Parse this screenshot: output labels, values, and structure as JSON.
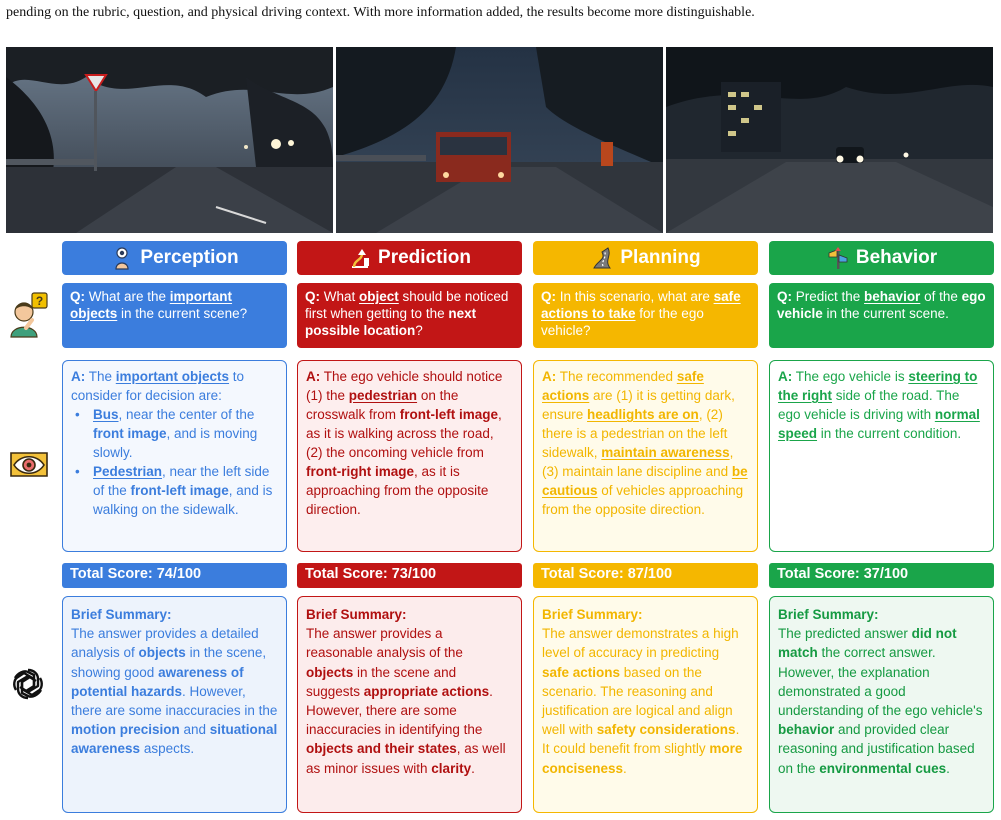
{
  "intro": "pending on the rubric, question, and physical driving context. With more information added, the results become more distinguishable.",
  "colors": {
    "blue": "#3b7ddd",
    "red": "#c21616",
    "yellow": "#f5b700",
    "green": "#1aa54a"
  },
  "side_icons": [
    "thinking-person-icon",
    "eye-icon",
    "openai-logo-icon"
  ],
  "photos": [
    {
      "name": "front-left-image",
      "scene": "night road with trees and yield sign"
    },
    {
      "name": "front-image",
      "scene": "night road with bus"
    },
    {
      "name": "front-right-image",
      "scene": "night road with oncoming vehicle"
    }
  ],
  "perception": {
    "title": "Perception",
    "q_label": "Q:",
    "q_t1": " What are the ",
    "q_u1": "important objects",
    "q_t2": " in the current scene?",
    "a_label": "A:",
    "a_t1": " The ",
    "a_u1": "important objects",
    "a_t2": " to consider for decision are:",
    "b1_u": "Bus",
    "b1_t1": ", near the center of the ",
    "b1_b": "front image",
    "b1_t2": ", and is moving slowly.",
    "b2_u": "Pedestrian",
    "b2_t1": ", near the left side of the ",
    "b2_b": "front-left image",
    "b2_t2": ", and is walking on the sidewalk.",
    "score": "Total Score: 74/100",
    "s_title": "Brief Summary:",
    "s_t1": "The answer provides a detailed analysis of ",
    "s_b1": "objects",
    "s_t2": " in the scene, showing good ",
    "s_b2": "awareness of potential hazards",
    "s_t3": ". However, there are some inaccuracies in the ",
    "s_b3": "motion precision",
    "s_t4": " and ",
    "s_b4": "situational awareness",
    "s_t5": " aspects."
  },
  "prediction": {
    "title": "Prediction",
    "q_label": "Q:",
    "q_t1": " What ",
    "q_u1": "object",
    "q_t2": " should be noticed first when getting to the ",
    "q_b1": "next possible location",
    "q_t3": "?",
    "a_label": "A:",
    "a_t1": " The ego vehicle should notice (1) the ",
    "a_u1": "pedestrian",
    "a_t2": " on the crosswalk from ",
    "a_b1": "front-left image",
    "a_t3": ", as it is walking across the road, (2) the oncoming vehicle from ",
    "a_b2": "front-right image",
    "a_t4": ", as it is approaching from the opposite direction.",
    "score": "Total Score: 73/100",
    "s_title": "Brief Summary:",
    "s_t1": "The answer provides a reasonable analysis of the ",
    "s_b1": "objects",
    "s_t2": " in the scene and suggests ",
    "s_b2": "appropriate actions",
    "s_t3": ". However, there are some inaccuracies in identifying the ",
    "s_b3": "objects and their states",
    "s_t4": ", as well as minor issues with ",
    "s_b4": "clarity",
    "s_t5": "."
  },
  "planning": {
    "title": "Planning",
    "q_label": "Q:",
    "q_t1": " In this scenario, what are ",
    "q_u1": "safe actions to take",
    "q_t2": " for the ego vehicle?",
    "a_label": "A:",
    "a_t1": " The recommended ",
    "a_u1": "safe actions",
    "a_t2": " are (1) it is getting dark, ensure ",
    "a_u2": "headlights are on",
    "a_t3": ", (2) there is a pedestrian on the left sidewalk, ",
    "a_u3": "maintain awareness",
    "a_t4": ", (3) maintain lane discipline and ",
    "a_u4": "be cautious",
    "a_t5": " of vehicles approaching from the opposite direction.",
    "score": "Total Score: 87/100",
    "s_title": "Brief Summary:",
    "s_t1": "The answer demonstrates a high level of accuracy in predicting ",
    "s_b1": "safe actions",
    "s_t2": " based on the scenario. The reasoning and justification are logical and align well with ",
    "s_b2": "safety considerations",
    "s_t3": ". It could benefit from slightly ",
    "s_b3": "more conciseness",
    "s_t4": "."
  },
  "behavior": {
    "title": "Behavior",
    "q_label": "Q:",
    "q_t1": " Predict the ",
    "q_u1": "behavior",
    "q_t2": " of the ",
    "q_b1": "ego vehicle",
    "q_t3": " in the current scene.",
    "a_label": "A:",
    "a_t1": " The ego vehicle is ",
    "a_u1": "steering to the right",
    "a_t2": " side of the road. The ego vehicle is driving with ",
    "a_u2": "normal speed",
    "a_t3": " in the current condition.",
    "score": "Total Score: 37/100",
    "s_title": "Brief Summary:",
    "s_t1": "The predicted answer ",
    "s_b1": "did not match",
    "s_t2": " the correct answer. However, the explanation demonstrated a good understanding of the ego vehicle's ",
    "s_b2": "behavior",
    "s_t3": " and provided clear reasoning and justification based on the ",
    "s_b3": "environmental cues",
    "s_t4": "."
  }
}
